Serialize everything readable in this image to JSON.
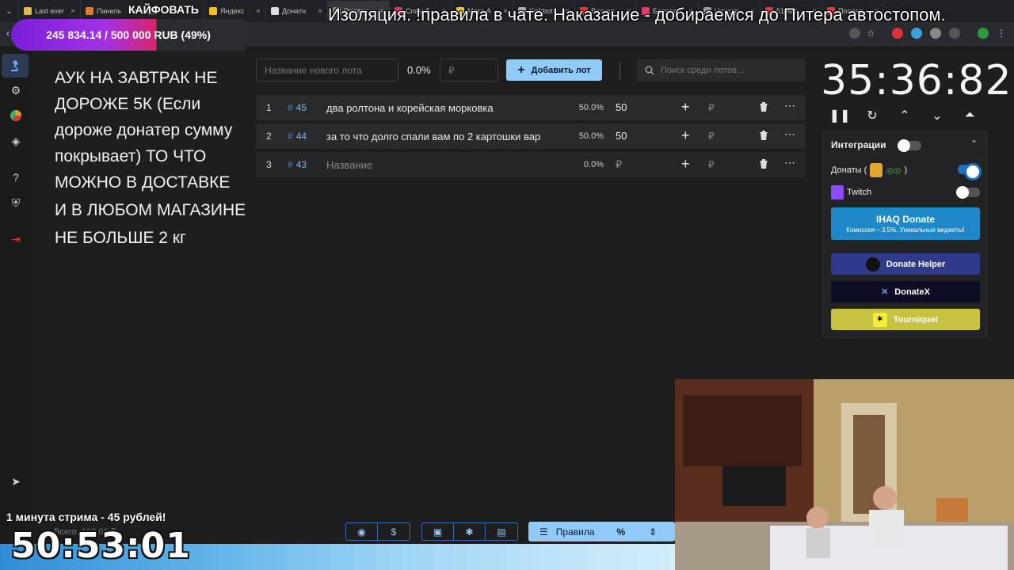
{
  "browser": {
    "tabs": [
      {
        "label": "Last ever"
      },
      {
        "label": "Панель"
      },
      {
        "label": ""
      },
      {
        "label": "Яндекс"
      },
      {
        "label": "Донатн"
      },
      {
        "label": "Pointau"
      },
      {
        "label": "Спам б"
      },
      {
        "label": "Мета А"
      },
      {
        "label": "Kickbot"
      },
      {
        "label": "Визуал"
      },
      {
        "label": "Боевое"
      },
      {
        "label": "Неиспр"
      },
      {
        "label": "51 час"
      },
      {
        "label": "Послед"
      }
    ]
  },
  "overlay": {
    "channel_name": "КАЙФОВАТЬ",
    "goal_text": "245 834.14 / 500 000 RUB (49%)",
    "goal_progress": 0.49,
    "marquee": "Изоляция. !правила в чате. Наказание - добираемся до Питера автостопом.",
    "promo": "1 минута стрима - 45 рублей!",
    "stream_clock": "50:53:01",
    "total_label": "Всего: 100.00 ₽"
  },
  "rules": {
    "paragraphs": [
      "АУК НА ЗАВТРАК НЕ ДОРОЖЕ 5К (Если дороже донатер сумму покрывает) ТО ЧТО МОЖНО В ДОСТАВКЕ",
      "И В ЛЮБОМ МАГАЗИНЕ",
      "НЕ БОЛЬШЕ 2 кг"
    ]
  },
  "toolbar": {
    "lot_name_placeholder": "Название нового лота",
    "percent": "0.0%",
    "amount_placeholder": "₽",
    "add_label": "Добавить лот",
    "search_placeholder": "Поиск среди лотов..."
  },
  "lots": [
    {
      "index": "1",
      "hash": "#",
      "id": "45",
      "name": "два ролтона и корейская морковка",
      "percent": "50.0%",
      "amount": "50",
      "currency": "₽"
    },
    {
      "index": "2",
      "hash": "#",
      "id": "44",
      "name": "за то что долго спали вам по 2 картошки вар",
      "percent": "50.0%",
      "amount": "50",
      "currency": "₽"
    },
    {
      "index": "3",
      "hash": "#",
      "id": "43",
      "name": "Название",
      "percent": "0.0%",
      "amount": "₽",
      "currency": "₽"
    }
  ],
  "timer": {
    "value": "35:36:82"
  },
  "integrations": {
    "title": "Интеграции",
    "donations_label": "Донаты (",
    "donations_suffix": ")",
    "twitch_label": "Twitch",
    "ihaq_title": "IHAQ Donate",
    "ihaq_sub": "Комиссия – 3,5%. Уникальные виджеты!",
    "donate_helper": "Donate Helper",
    "donatex": "DonateX",
    "tourniquet": "Tourniquet"
  },
  "bottom_bar": {
    "rules_label": "Правила"
  },
  "colors": {
    "accent": "#90caf9",
    "link_blue": "#4a86c8",
    "panel_bg": "#232325",
    "ihaq": "#1e88c8",
    "donate_helper": "#2f3a8a",
    "donatex": "#0c0c22",
    "tourniquet": "#c6c342"
  }
}
